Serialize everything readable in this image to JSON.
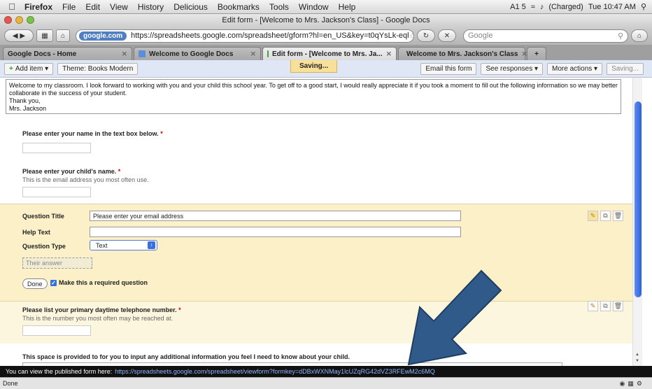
{
  "menubar": {
    "app": "Firefox",
    "items": [
      "File",
      "Edit",
      "View",
      "History",
      "Delicious",
      "Bookmarks",
      "Tools",
      "Window",
      "Help"
    ],
    "status_icons": "A1 5",
    "battery": "(Charged)",
    "clock": "Tue 10:47 AM"
  },
  "window": {
    "title": "Edit form - [Welcome to Mrs. Jackson's Class] - Google Docs"
  },
  "navbar": {
    "site_badge": "google.com",
    "url": "https://spreadsheets.google.com/spreadsheet/gform?hl=en_US&key=t0qYsLk-eql",
    "search_placeholder": "Google"
  },
  "tabs": [
    {
      "label": "Google Docs - Home"
    },
    {
      "label": "Welcome to Google Docs"
    },
    {
      "label": "Edit form - [Welcome to Mrs. Ja..."
    },
    {
      "label": "Welcome to Mrs. Jackson's Class"
    }
  ],
  "toolbar": {
    "add_item": "Add item",
    "theme": "Theme: Books Modern",
    "saving": "Saving...",
    "email": "Email this form",
    "responses": "See responses",
    "more": "More actions",
    "save": "Saving..."
  },
  "form": {
    "intro_line1": "Welcome to my classroom. I look forward to working with you and your child this school year. To get off to a good start, I would really appreciate it if you took a moment to fill out the following information so we may better",
    "intro_line2": "collaborate in the success of your student.",
    "intro_line3": "Thank you,",
    "intro_line4": "Mrs. Jackson",
    "q1_title": "Please enter your name in the text box below.",
    "q2_title": "Please enter your child's name.",
    "q2_help": "This is the email address you most often use.",
    "edit": {
      "title_label": "Question Title",
      "title_value": "Please enter your email address",
      "help_label": "Help Text",
      "help_value": "",
      "type_label": "Question Type",
      "type_value": "Text",
      "preview_placeholder": "Their answer",
      "done": "Done",
      "required": "Make this a required question"
    },
    "q3_title": "Please list your primary daytime telephone number.",
    "q3_help": "This is the number you most often may be reached at.",
    "q4_title": "This space is provided to for you to input any additional information you feel I need to know about your child.",
    "star": "*"
  },
  "pubbar": {
    "text": "You can view the published form here:",
    "link": "https://spreadsheets.google.com/spreadsheet/viewform?formkey=dDBxWXNMay1lcUZqRG42dVZ3RFEwM2c6MQ"
  },
  "status": {
    "text": "Done"
  },
  "colors": {
    "accent": "#2e62d8",
    "panel": "#fbf0c8",
    "arrow": "#2f5a8a"
  }
}
